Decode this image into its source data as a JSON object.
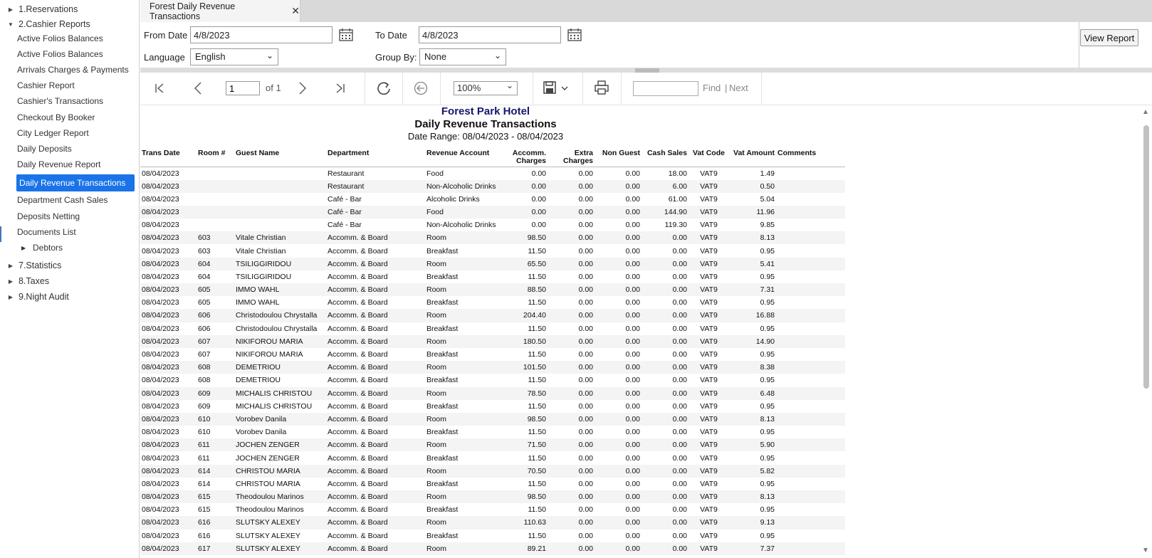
{
  "sidebar": {
    "groups": [
      {
        "label": "1.Reservations",
        "expanded": false
      },
      {
        "label": "2.Cashier Reports",
        "expanded": true
      },
      {
        "label": "7.Statistics",
        "expanded": false
      },
      {
        "label": "8.Taxes",
        "expanded": false
      },
      {
        "label": "9.Night Audit",
        "expanded": false
      }
    ],
    "items": [
      "Active Folios Balances",
      "Active Folios Balances",
      "Arrivals Charges & Payments",
      "Cashier Report",
      "Cashier's Transactions",
      "Checkout By Booker",
      "City Ledger Report",
      "Daily Deposits",
      "Daily Revenue Report",
      "Daily Revenue Transactions",
      "Department Cash Sales",
      "Deposits Netting",
      "Documents List"
    ],
    "subgroup": "Debtors",
    "selected_item": "Daily Revenue Transactions"
  },
  "tab": {
    "title": "Forest Daily Revenue Transactions"
  },
  "params": {
    "from_date_label": "From Date",
    "from_date": "4/8/2023",
    "to_date_label": "To Date",
    "to_date": "4/8/2023",
    "language_label": "Language",
    "language": "English",
    "group_by_label": "Group By:",
    "group_by": "None",
    "view_report": "View Report"
  },
  "toolbar": {
    "page": "1",
    "of_pages": "of 1",
    "zoom": "100%",
    "find": "Find",
    "next": "Next"
  },
  "report": {
    "hotel": "Forest Park Hotel",
    "title": "Daily Revenue Transactions",
    "date_range": "Date Range: 08/04/2023 - 08/04/2023",
    "columns": [
      "Trans Date",
      "Room #",
      "Guest Name",
      "Department",
      "Revenue Account",
      "Accomm. Charges",
      "Extra Charges",
      "Non Guest",
      "Cash Sales",
      "Vat Code",
      "Vat Amount",
      "Comments"
    ],
    "rows": [
      [
        "08/04/2023",
        "",
        "",
        "Restaurant",
        "Food",
        "0.00",
        "0.00",
        "0.00",
        "18.00",
        "VAT9",
        "1.49",
        ""
      ],
      [
        "08/04/2023",
        "",
        "",
        "Restaurant",
        "Non-Alcoholic Drinks",
        "0.00",
        "0.00",
        "0.00",
        "6.00",
        "VAT9",
        "0.50",
        ""
      ],
      [
        "08/04/2023",
        "",
        "",
        "Café  - Bar",
        "Alcoholic Drinks",
        "0.00",
        "0.00",
        "0.00",
        "61.00",
        "VAT9",
        "5.04",
        ""
      ],
      [
        "08/04/2023",
        "",
        "",
        "Café  - Bar",
        "Food",
        "0.00",
        "0.00",
        "0.00",
        "144.90",
        "VAT9",
        "11.96",
        ""
      ],
      [
        "08/04/2023",
        "",
        "",
        "Café  - Bar",
        "Non-Alcoholic Drinks",
        "0.00",
        "0.00",
        "0.00",
        "119.30",
        "VAT9",
        "9.85",
        ""
      ],
      [
        "08/04/2023",
        "603",
        "Vitale Christian",
        "Accomm.  & Board",
        "Room",
        "98.50",
        "0.00",
        "0.00",
        "0.00",
        "VAT9",
        "8.13",
        ""
      ],
      [
        "08/04/2023",
        "603",
        "Vitale Christian",
        "Accomm.  & Board",
        "Breakfast",
        "11.50",
        "0.00",
        "0.00",
        "0.00",
        "VAT9",
        "0.95",
        ""
      ],
      [
        "08/04/2023",
        "604",
        "TSILIGGIRIDOU",
        "Accomm.  & Board",
        "Room",
        "65.50",
        "0.00",
        "0.00",
        "0.00",
        "VAT9",
        "5.41",
        ""
      ],
      [
        "08/04/2023",
        "604",
        "TSILIGGIRIDOU",
        "Accomm.  & Board",
        "Breakfast",
        "11.50",
        "0.00",
        "0.00",
        "0.00",
        "VAT9",
        "0.95",
        ""
      ],
      [
        "08/04/2023",
        "605",
        "IMMO WAHL",
        "Accomm.  & Board",
        "Room",
        "88.50",
        "0.00",
        "0.00",
        "0.00",
        "VAT9",
        "7.31",
        ""
      ],
      [
        "08/04/2023",
        "605",
        "IMMO WAHL",
        "Accomm.  & Board",
        "Breakfast",
        "11.50",
        "0.00",
        "0.00",
        "0.00",
        "VAT9",
        "0.95",
        ""
      ],
      [
        "08/04/2023",
        "606",
        "Christodoulou Chrystalla",
        "Accomm.  & Board",
        "Room",
        "204.40",
        "0.00",
        "0.00",
        "0.00",
        "VAT9",
        "16.88",
        ""
      ],
      [
        "08/04/2023",
        "606",
        "Christodoulou Chrystalla",
        "Accomm.  & Board",
        "Breakfast",
        "11.50",
        "0.00",
        "0.00",
        "0.00",
        "VAT9",
        "0.95",
        ""
      ],
      [
        "08/04/2023",
        "607",
        "NIKIFOROU MARIA",
        "Accomm.  & Board",
        "Room",
        "180.50",
        "0.00",
        "0.00",
        "0.00",
        "VAT9",
        "14.90",
        ""
      ],
      [
        "08/04/2023",
        "607",
        "NIKIFOROU MARIA",
        "Accomm.  & Board",
        "Breakfast",
        "11.50",
        "0.00",
        "0.00",
        "0.00",
        "VAT9",
        "0.95",
        ""
      ],
      [
        "08/04/2023",
        "608",
        "DEMETRIOU",
        "Accomm.  & Board",
        "Room",
        "101.50",
        "0.00",
        "0.00",
        "0.00",
        "VAT9",
        "8.38",
        ""
      ],
      [
        "08/04/2023",
        "608",
        "DEMETRIOU",
        "Accomm.  & Board",
        "Breakfast",
        "11.50",
        "0.00",
        "0.00",
        "0.00",
        "VAT9",
        "0.95",
        ""
      ],
      [
        "08/04/2023",
        "609",
        "MICHALIS CHRISTOU",
        "Accomm.  & Board",
        "Room",
        "78.50",
        "0.00",
        "0.00",
        "0.00",
        "VAT9",
        "6.48",
        ""
      ],
      [
        "08/04/2023",
        "609",
        "MICHALIS CHRISTOU",
        "Accomm.  & Board",
        "Breakfast",
        "11.50",
        "0.00",
        "0.00",
        "0.00",
        "VAT9",
        "0.95",
        ""
      ],
      [
        "08/04/2023",
        "610",
        "Vorobev Danila",
        "Accomm.  & Board",
        "Room",
        "98.50",
        "0.00",
        "0.00",
        "0.00",
        "VAT9",
        "8.13",
        ""
      ],
      [
        "08/04/2023",
        "610",
        "Vorobev Danila",
        "Accomm.  & Board",
        "Breakfast",
        "11.50",
        "0.00",
        "0.00",
        "0.00",
        "VAT9",
        "0.95",
        ""
      ],
      [
        "08/04/2023",
        "611",
        "JOCHEN ZENGER",
        "Accomm.  & Board",
        "Room",
        "71.50",
        "0.00",
        "0.00",
        "0.00",
        "VAT9",
        "5.90",
        ""
      ],
      [
        "08/04/2023",
        "611",
        "JOCHEN ZENGER",
        "Accomm.  & Board",
        "Breakfast",
        "11.50",
        "0.00",
        "0.00",
        "0.00",
        "VAT9",
        "0.95",
        ""
      ],
      [
        "08/04/2023",
        "614",
        "CHRISTOU MARIA",
        "Accomm.  & Board",
        "Room",
        "70.50",
        "0.00",
        "0.00",
        "0.00",
        "VAT9",
        "5.82",
        ""
      ],
      [
        "08/04/2023",
        "614",
        "CHRISTOU MARIA",
        "Accomm.  & Board",
        "Breakfast",
        "11.50",
        "0.00",
        "0.00",
        "0.00",
        "VAT9",
        "0.95",
        ""
      ],
      [
        "08/04/2023",
        "615",
        "Theodoulou Marinos",
        "Accomm.  & Board",
        "Room",
        "98.50",
        "0.00",
        "0.00",
        "0.00",
        "VAT9",
        "8.13",
        ""
      ],
      [
        "08/04/2023",
        "615",
        "Theodoulou Marinos",
        "Accomm.  & Board",
        "Breakfast",
        "11.50",
        "0.00",
        "0.00",
        "0.00",
        "VAT9",
        "0.95",
        ""
      ],
      [
        "08/04/2023",
        "616",
        "SLUTSKY ALEXEY",
        "Accomm.  & Board",
        "Room",
        "110.63",
        "0.00",
        "0.00",
        "0.00",
        "VAT9",
        "9.13",
        ""
      ],
      [
        "08/04/2023",
        "616",
        "SLUTSKY ALEXEY",
        "Accomm.  & Board",
        "Breakfast",
        "11.50",
        "0.00",
        "0.00",
        "0.00",
        "VAT9",
        "0.95",
        ""
      ],
      [
        "08/04/2023",
        "617",
        "SLUTSKY ALEXEY",
        "Accomm.  & Board",
        "Room",
        "89.21",
        "0.00",
        "0.00",
        "0.00",
        "VAT9",
        "7.37",
        ""
      ]
    ]
  },
  "colors": {
    "selected_bg": "#1a73e8",
    "hotel_title": "#16166e",
    "tab_bar": "#d9d9d9"
  }
}
